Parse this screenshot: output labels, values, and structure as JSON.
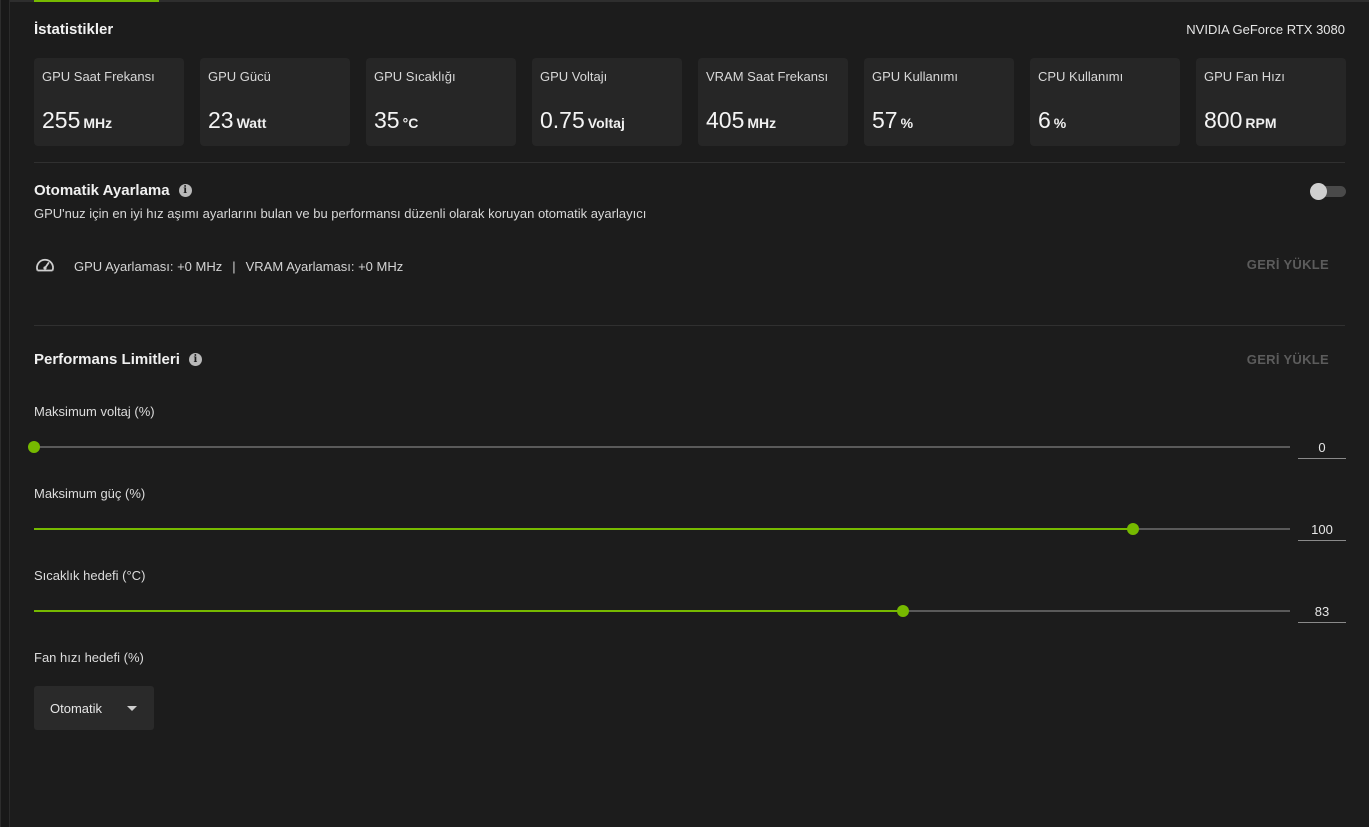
{
  "stats_section": {
    "title": "İstatistikler",
    "gpu_name": "NVIDIA GeForce RTX 3080",
    "cards": [
      {
        "label": "GPU Saat Frekansı",
        "value": "255",
        "unit": "MHz"
      },
      {
        "label": "GPU Gücü",
        "value": "23",
        "unit": "Watt"
      },
      {
        "label": "GPU Sıcaklığı",
        "value": "35",
        "unit": "°C"
      },
      {
        "label": "GPU Voltajı",
        "value": "0.75",
        "unit": "Voltaj"
      },
      {
        "label": "VRAM Saat Frekansı",
        "value": "405",
        "unit": "MHz"
      },
      {
        "label": "GPU Kullanımı",
        "value": "57",
        "unit": "%"
      },
      {
        "label": "CPU Kullanımı",
        "value": "6",
        "unit": "%"
      },
      {
        "label": "GPU Fan Hızı",
        "value": "800",
        "unit": "RPM"
      }
    ]
  },
  "auto_tune": {
    "title": "Otomatik Ayarlama",
    "info_icon": "i",
    "description": "GPU'nuz için en iyi hız aşımı ayarlarını bulan ve bu performansı düzenli olarak koruyan otomatik ayarlayıcı",
    "enabled": false,
    "gpu_tuning": "GPU Ayarlaması: +0 MHz",
    "separator": "|",
    "vram_tuning": "VRAM Ayarlaması: +0 MHz",
    "reset_label": "GERİ YÜKLE"
  },
  "performance_limits": {
    "title": "Performans Limitleri",
    "info_icon": "i",
    "reset_label": "GERİ YÜKLE",
    "sliders": [
      {
        "label": "Maksimum voltaj (%)",
        "value": "0",
        "fill_fraction": 0.0
      },
      {
        "label": "Maksimum güç (%)",
        "value": "100",
        "fill_fraction": 0.875
      },
      {
        "label": "Sıcaklık hedefi (°C)",
        "value": "83",
        "fill_fraction": 0.692
      }
    ],
    "fan_target": {
      "label": "Fan hızı hedefi (%)",
      "selected": "Otomatik"
    }
  },
  "colors": {
    "accent": "#76b900",
    "background": "#1c1c1c",
    "card": "#262626",
    "disabled_text": "#5c5c5c"
  }
}
